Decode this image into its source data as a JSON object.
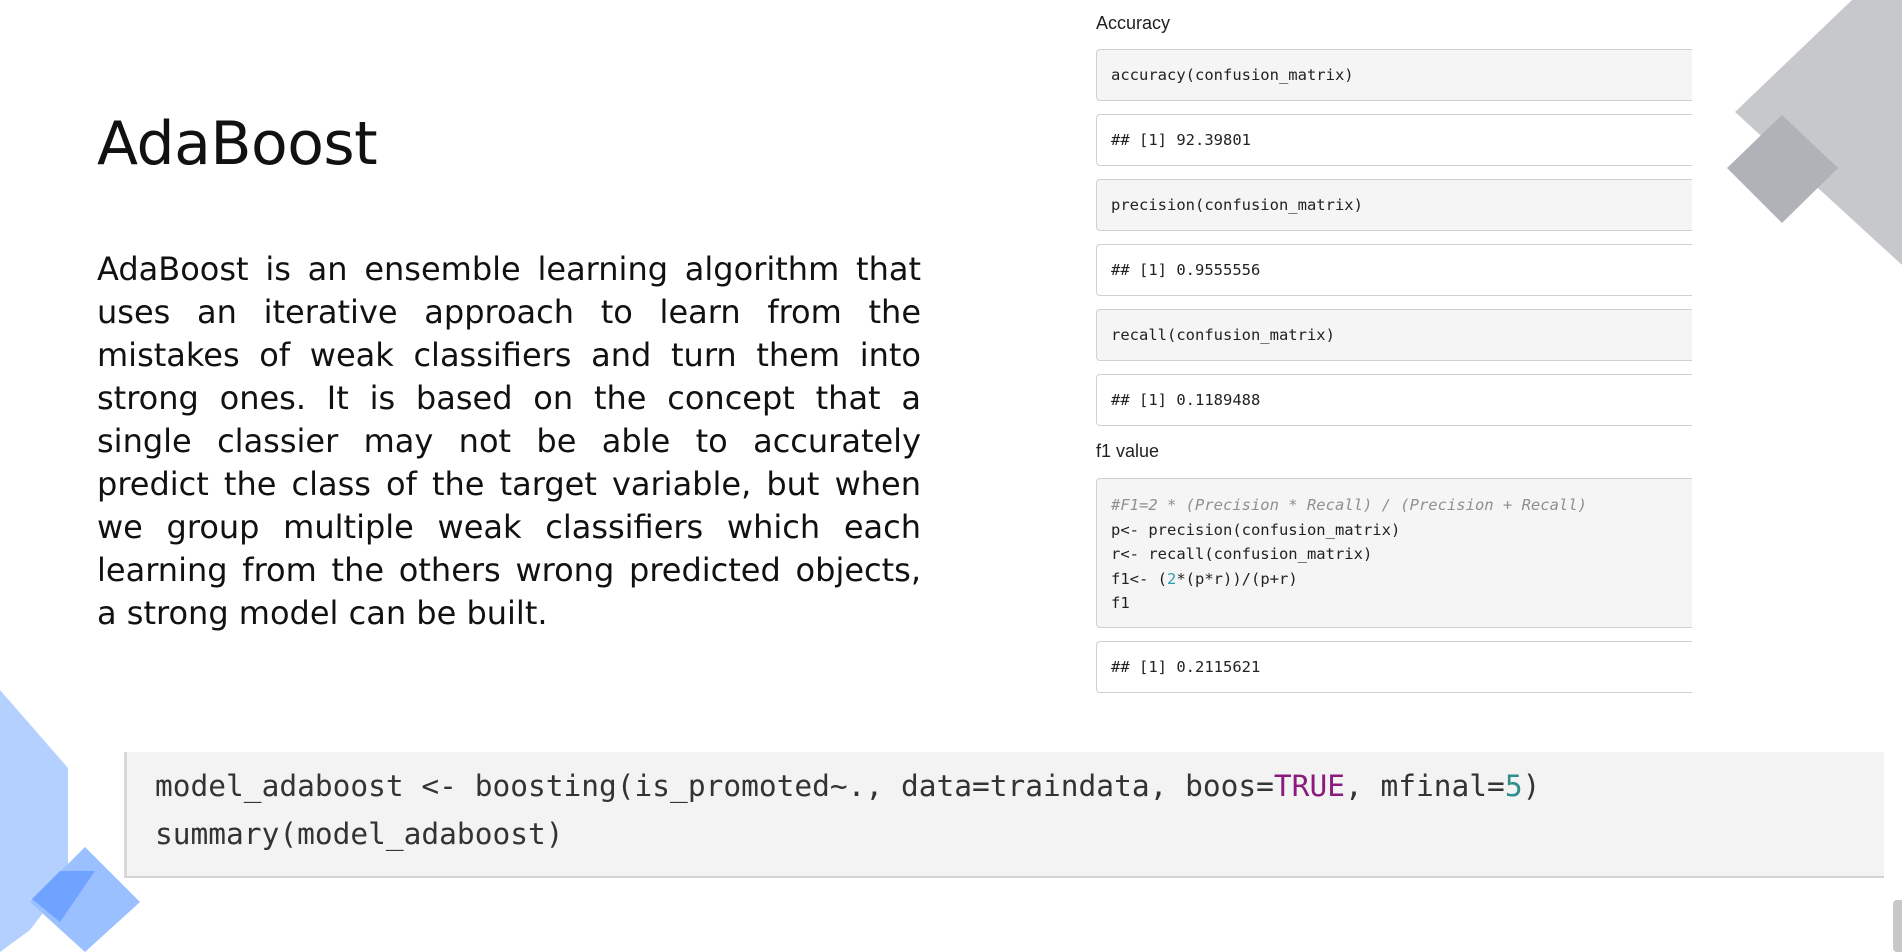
{
  "slide": {
    "title": "AdaBoost",
    "body": "AdaBoost is an ensemble learning algorithm that uses an iterative approach to learn from the mistakes of weak classifiers and turn them into strong ones. It is based on the concept that a single classier may not be able to accurately predict the class of the target variable, but when we group multiple weak classifiers which each learning from the others wrong predicted objects, a strong model can be built."
  },
  "panel": {
    "accuracy_label": "Accuracy",
    "blocks": [
      {
        "kind": "code",
        "text": "accuracy(confusion_matrix)"
      },
      {
        "kind": "out",
        "text": "## [1] 92.39801"
      },
      {
        "kind": "code",
        "text": "precision(confusion_matrix)"
      },
      {
        "kind": "out",
        "text": "## [1] 0.9555556"
      },
      {
        "kind": "code",
        "text": "recall(confusion_matrix)"
      },
      {
        "kind": "out",
        "text": "## [1] 0.1189488"
      }
    ],
    "f1_label": "f1 value",
    "f1_code": {
      "comment": "#F1=2 * (Precision * Recall) / (Precision + Recall)",
      "line1": "p<- precision(confusion_matrix)",
      "line2": "r<- recall(confusion_matrix)",
      "line3_pre": "f1<- (",
      "line3_num": "2",
      "line3_post": "*(p*r))/(p+r)",
      "line4": "f1"
    },
    "f1_output": "## [1] 0.2115621"
  },
  "bottom_code": {
    "line1_pre": "model_adaboost <- boosting(is_promoted~., data=traindata, boos=",
    "line1_kw": "TRUE",
    "line1_mid": ", mfinal=",
    "line1_num": "5",
    "line1_end": ")",
    "line2": "summary(model_adaboost)"
  },
  "colors": {
    "deco_gray": "#c4c6ca",
    "deco_gray_dark": "#a9abb0",
    "deco_blue": "#adcbff",
    "deco_blue_dark": "#7fb0ff",
    "keyword": "#8a1b7c",
    "number": "#2d9db0"
  }
}
